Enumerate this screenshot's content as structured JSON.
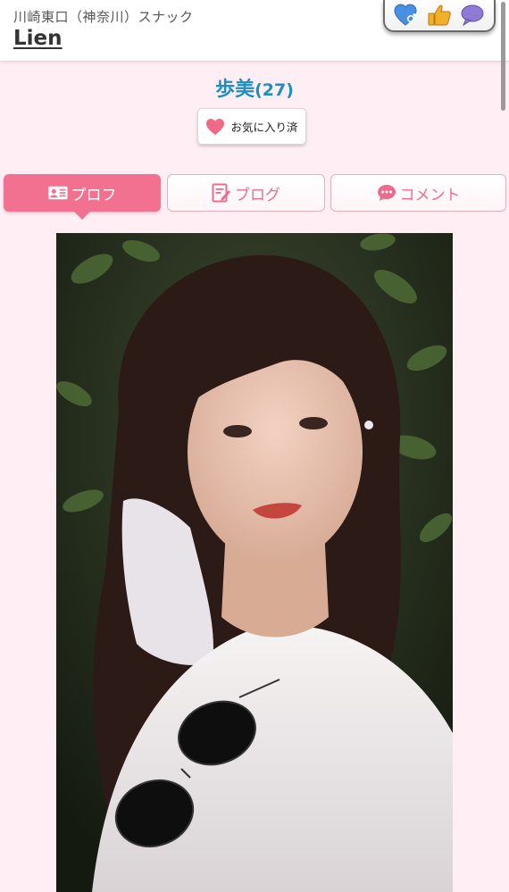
{
  "header": {
    "breadcrumb": "川崎東口（神奈川）スナック",
    "shop_name": "Lien",
    "actions": [
      {
        "icon": "heart-gender-icon",
        "color": "#4a90e2"
      },
      {
        "icon": "thumbs-up-icon",
        "color": "#f0a020"
      },
      {
        "icon": "speech-bubble-icon",
        "color": "#8a74d0"
      }
    ]
  },
  "cast": {
    "name": "歩美",
    "age": "(27)",
    "favorite_label": "お気に入り済"
  },
  "tabs": [
    {
      "label": "プロフ",
      "icon": "profile-card-icon",
      "active": true
    },
    {
      "label": "ブログ",
      "icon": "edit-note-icon",
      "active": false
    },
    {
      "label": "コメント",
      "icon": "chat-bubble-icon",
      "active": false
    }
  ],
  "colors": {
    "accent": "#f27190",
    "name_blue": "#1c8fc1",
    "background": "#ffeef3"
  },
  "photo": {
    "icon": "cast-photo-image"
  }
}
